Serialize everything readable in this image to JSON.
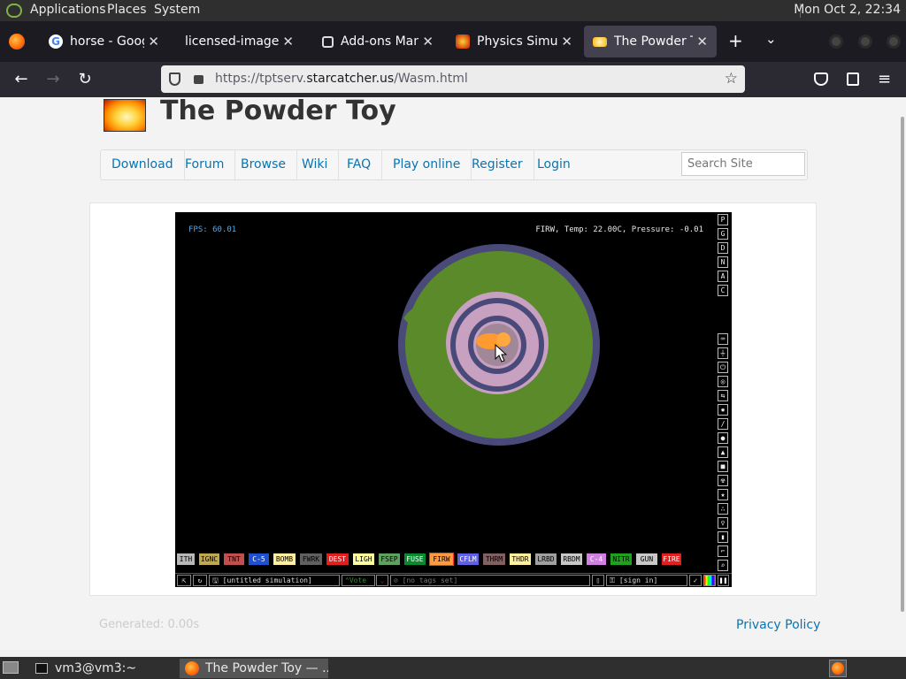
{
  "topbar": {
    "menus": [
      "Applications",
      "Places",
      "System"
    ],
    "clock": "Mon Oct  2, 22:34"
  },
  "tabs": [
    {
      "title": "horse - Google Se",
      "favicon": "google-icon"
    },
    {
      "title": "licensed-image (JPE",
      "favicon": "none"
    },
    {
      "title": "Add-ons Manage",
      "favicon": "puzzle-icon"
    },
    {
      "title": "Physics Simulatio",
      "favicon": "powder-toy-icon"
    },
    {
      "title": "The Powder Toy",
      "favicon": "powder-toy-icon",
      "active": true
    }
  ],
  "navbar": {
    "url_prefix": "https://tptserv.",
    "url_domain": "starcatcher.us",
    "url_suffix": "/Wasm.html"
  },
  "site": {
    "title": "The Powder Toy",
    "nav": [
      "Download",
      "Forum",
      "Browse",
      "Wiki",
      "FAQ",
      "Play online",
      "Register",
      "Login"
    ],
    "search_placeholder": "Search Site",
    "footer_generated": "Generated: 0.00s",
    "privacy_policy": "Privacy Policy"
  },
  "simulation": {
    "fps": "FPS: 60.01",
    "status": "FIRW, Temp: 22.00C, Pressure: -0.01",
    "top_buttons": [
      "P",
      "G",
      "D",
      "N",
      "A",
      "C"
    ],
    "elements": [
      {
        "label": "ITH",
        "bg": "#b8b8b8",
        "fg": "#000"
      },
      {
        "label": "IGNC",
        "bg": "#c0a850",
        "fg": "#000"
      },
      {
        "label": "TNT",
        "bg": "#c05050",
        "fg": "#000"
      },
      {
        "label": "C-5",
        "bg": "#2050d0",
        "fg": "#fff"
      },
      {
        "label": "BOMB",
        "bg": "#fff0a0",
        "fg": "#000"
      },
      {
        "label": "FWRK",
        "bg": "#606060",
        "fg": "#000"
      },
      {
        "label": "DEST",
        "bg": "#e02020",
        "fg": "#fff"
      },
      {
        "label": "LIGH",
        "bg": "#ffffa0",
        "fg": "#000"
      },
      {
        "label": "FSEP",
        "bg": "#60a060",
        "fg": "#000"
      },
      {
        "label": "FUSE",
        "bg": "#0a8a30",
        "fg": "#fff"
      },
      {
        "label": "FIRW",
        "bg": "#ff9a40",
        "fg": "#000",
        "selected": true
      },
      {
        "label": "CFLM",
        "bg": "#6060e0",
        "fg": "#fff"
      },
      {
        "label": "THRM",
        "bg": "#806060",
        "fg": "#000"
      },
      {
        "label": "THDR",
        "bg": "#fff0a0",
        "fg": "#000"
      },
      {
        "label": "LRBD",
        "bg": "#a0a0a0",
        "fg": "#000"
      },
      {
        "label": "RBDM",
        "bg": "#c8c8c8",
        "fg": "#000"
      },
      {
        "label": "C-4",
        "bg": "#d080e0",
        "fg": "#fff"
      },
      {
        "label": "NITR",
        "bg": "#20a020",
        "fg": "#000"
      },
      {
        "label": "GUN",
        "bg": "#c8c8c8",
        "fg": "#000"
      },
      {
        "label": "FIRE",
        "bg": "#e02020",
        "fg": "#fff"
      }
    ],
    "bottom": {
      "save_name": "[untitled simulation]",
      "vote": "Vote",
      "tags": "[no tags set]",
      "sign_in": "[sign in]"
    }
  },
  "taskbar": {
    "terminal": "vm3@vm3:~",
    "firefox": "The Powder Toy — ..."
  },
  "colors": {
    "link": "#0a74b0",
    "firefox_dark": "#1c1b22",
    "sim_green": "#5a8a2a",
    "sim_ring": "#4a4a7a",
    "sim_pink": "#c8a0c0"
  }
}
